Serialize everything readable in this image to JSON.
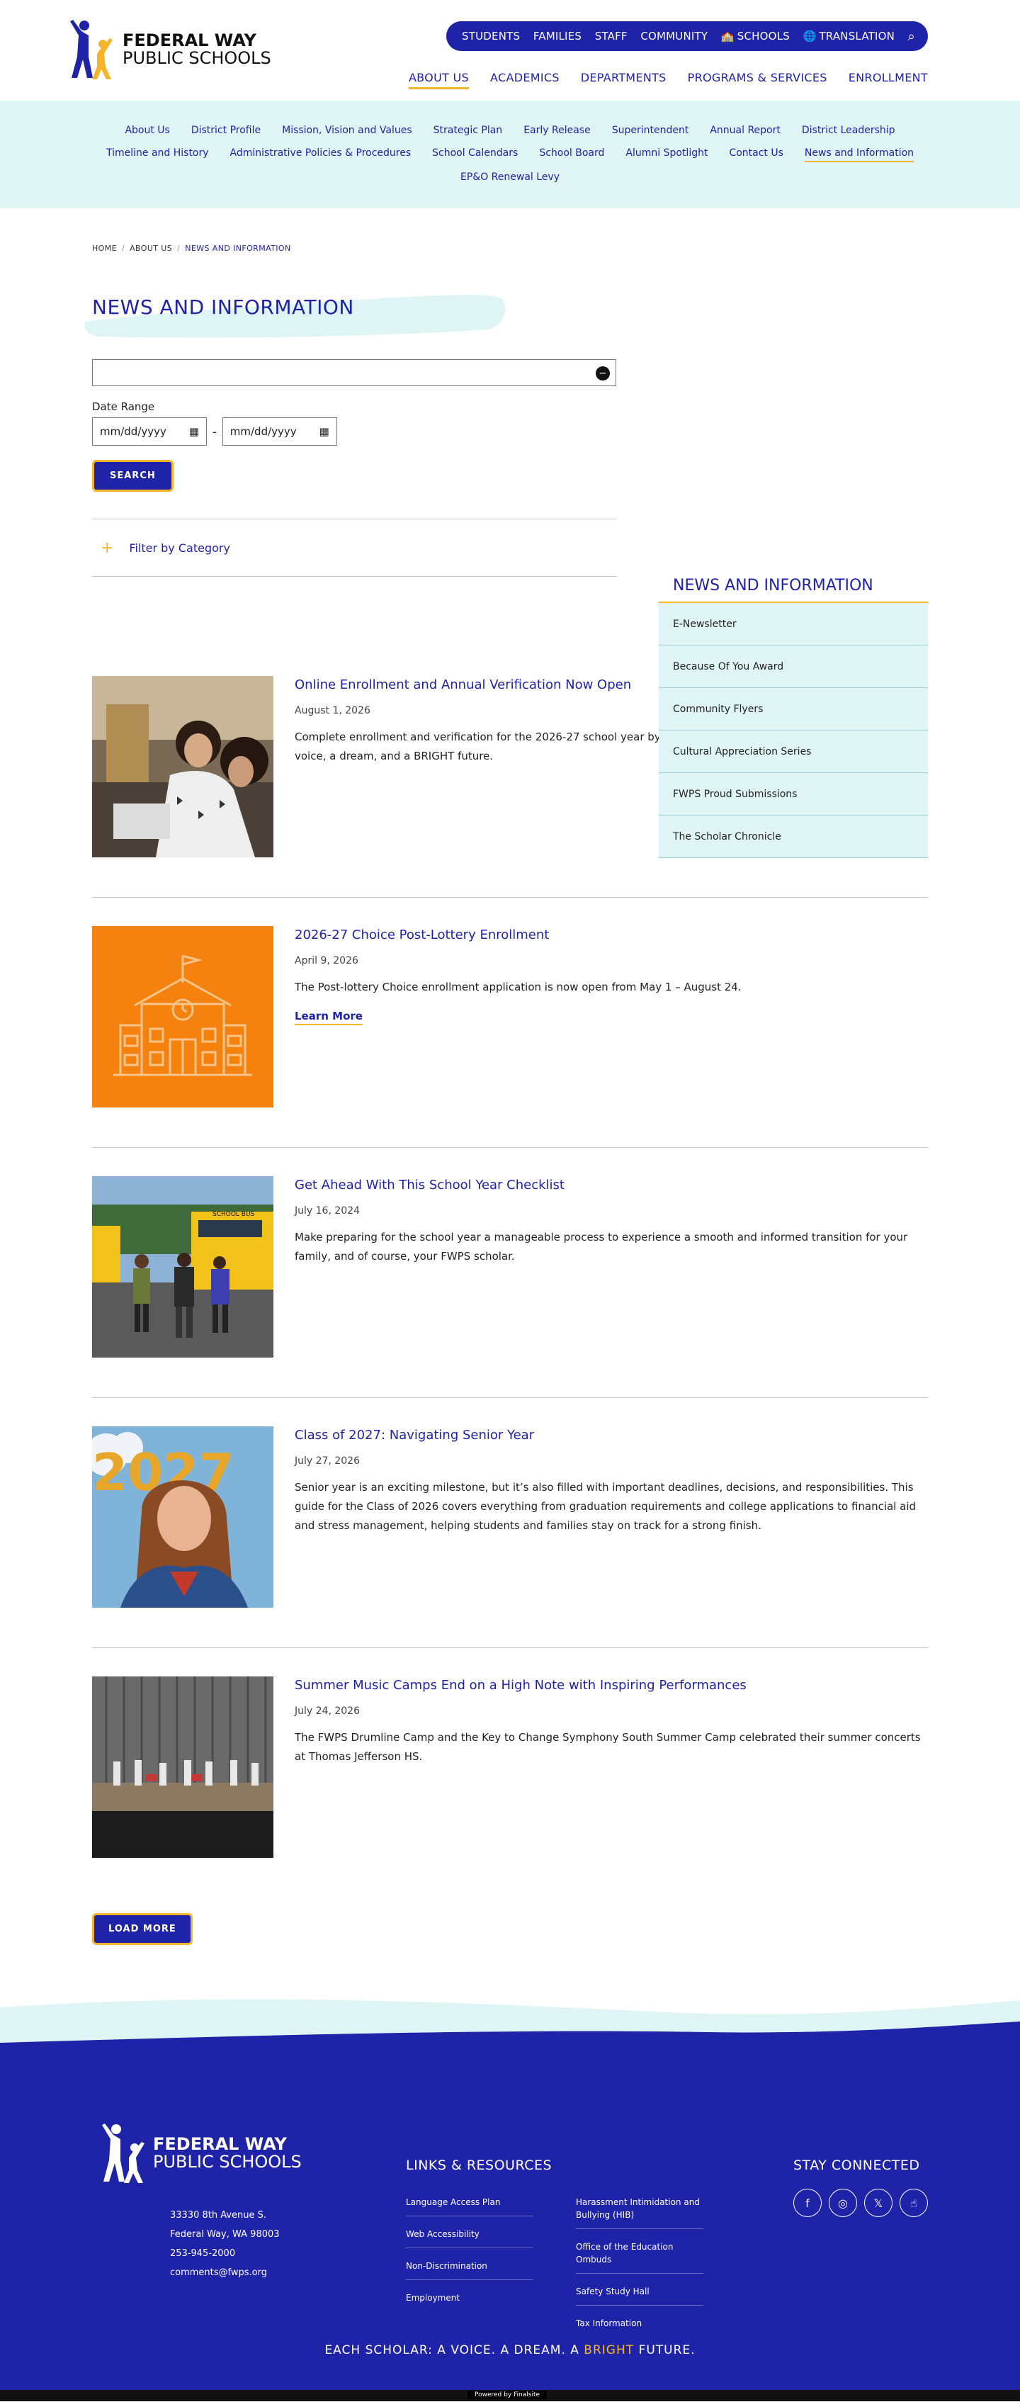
{
  "logo": {
    "line1": "FEDERAL WAY",
    "line2": "PUBLIC SCHOOLS"
  },
  "utility": {
    "students": "STUDENTS",
    "families": "FAMILIES",
    "staff": "STAFF",
    "community": "COMMUNITY",
    "schools": "SCHOOLS",
    "translation": "TRANSLATION"
  },
  "mainnav": [
    "ABOUT US",
    "ACADEMICS",
    "DEPARTMENTS",
    "PROGRAMS & SERVICES",
    "ENROLLMENT"
  ],
  "subnav": {
    "row1": [
      "About Us",
      "District Profile",
      "Mission, Vision and Values",
      "Strategic Plan",
      "Early Release",
      "Superintendent",
      "Annual Report",
      "District Leadership"
    ],
    "row2": [
      "Timeline and History",
      "Administrative Policies & Procedures",
      "School Calendars",
      "School Board",
      "Alumni Spotlight",
      "Contact Us",
      "News and Information"
    ],
    "row3": [
      "EP&O Renewal Levy"
    ]
  },
  "breadcrumb": [
    "HOME",
    "ABOUT US",
    "NEWS AND INFORMATION"
  ],
  "page_title": "NEWS AND INFORMATION",
  "filters": {
    "date_range_label": "Date Range",
    "date_placeholder": "mm/dd/yyyy",
    "search_label": "SEARCH",
    "filter_category_label": "Filter by Category"
  },
  "sidebar": {
    "title": "NEWS AND INFORMATION",
    "items": [
      "E-Newsletter",
      "Because Of You Award",
      "Community Flyers",
      "Cultural Appreciation Series",
      "FWPS Proud Submissions",
      "The Scholar Chronicle"
    ]
  },
  "news": [
    {
      "title": "Online Enrollment and Annual Verification Now Open",
      "date": "August 1, 2026",
      "text": "Complete enrollment and verification for the 2026-27 school year by September 2. Join FWPS where scholars have a voice, a dream, and a BRIGHT future."
    },
    {
      "title": "2026-27 Choice Post-Lottery Enrollment",
      "date": "April 9, 2026",
      "text": "The Post-lottery Choice enrollment application is now open from May 1 – August 24.",
      "link": "Learn More"
    },
    {
      "title": "Get Ahead With This School Year Checklist",
      "date": "July 16, 2024",
      "text": "Make preparing for the school year a manageable process to experience a smooth and informed transition for your family, and of course, your FWPS scholar."
    },
    {
      "title": "Class of 2027: Navigating Senior Year",
      "date": "July 27, 2026",
      "text": "Senior year is an exciting milestone, but it’s also filled with important deadlines, decisions, and responsibilities. This guide for the Class of 2026 covers everything from graduation requirements and college applications to financial aid and stress management, helping students and families stay on track for a strong finish."
    },
    {
      "title": "Summer Music Camps End on a High Note with Inspiring Performances",
      "date": "July 24, 2026",
      "text": "The FWPS Drumline Camp and the Key to Change Symphony South Summer Camp celebrated their summer concerts at Thomas Jefferson HS."
    }
  ],
  "thumb_text": {
    "bus": "SCHOOL BUS",
    "year": "2027"
  },
  "load_more": "LOAD MORE",
  "footer": {
    "logo_line1": "FEDERAL WAY",
    "logo_line2": "PUBLIC SCHOOLS",
    "address1": "33330 8th Avenue S.",
    "address2": "Federal Way, WA  98003",
    "phone": "253-945-2000",
    "email": "comments@fwps.org",
    "links_title": "LINKS & RESOURCES",
    "links_col1": [
      "Language Access Plan",
      "Web Accessibility",
      "Non-Discrimination",
      "Employment"
    ],
    "links_col2": [
      "Harassment Intimidation and Bullying (HIB)",
      "Office of the Education Ombuds",
      "Safety Study Hall",
      "Tax Information"
    ],
    "stay_title": "STAY CONNECTED",
    "social_glyphs": [
      "f",
      "◎",
      "𝕏",
      "☝"
    ],
    "tagline_pre": "EACH SCHOLAR: A VOICE. A DREAM. A ",
    "tagline_bright": "BRIGHT",
    "tagline_post": " FUTURE.",
    "powered": "Powered by Finalsite"
  },
  "colors": {
    "brand_blue": "#1f23a8",
    "accent_gold": "#f5b52a",
    "light_teal": "#dff4f5"
  }
}
